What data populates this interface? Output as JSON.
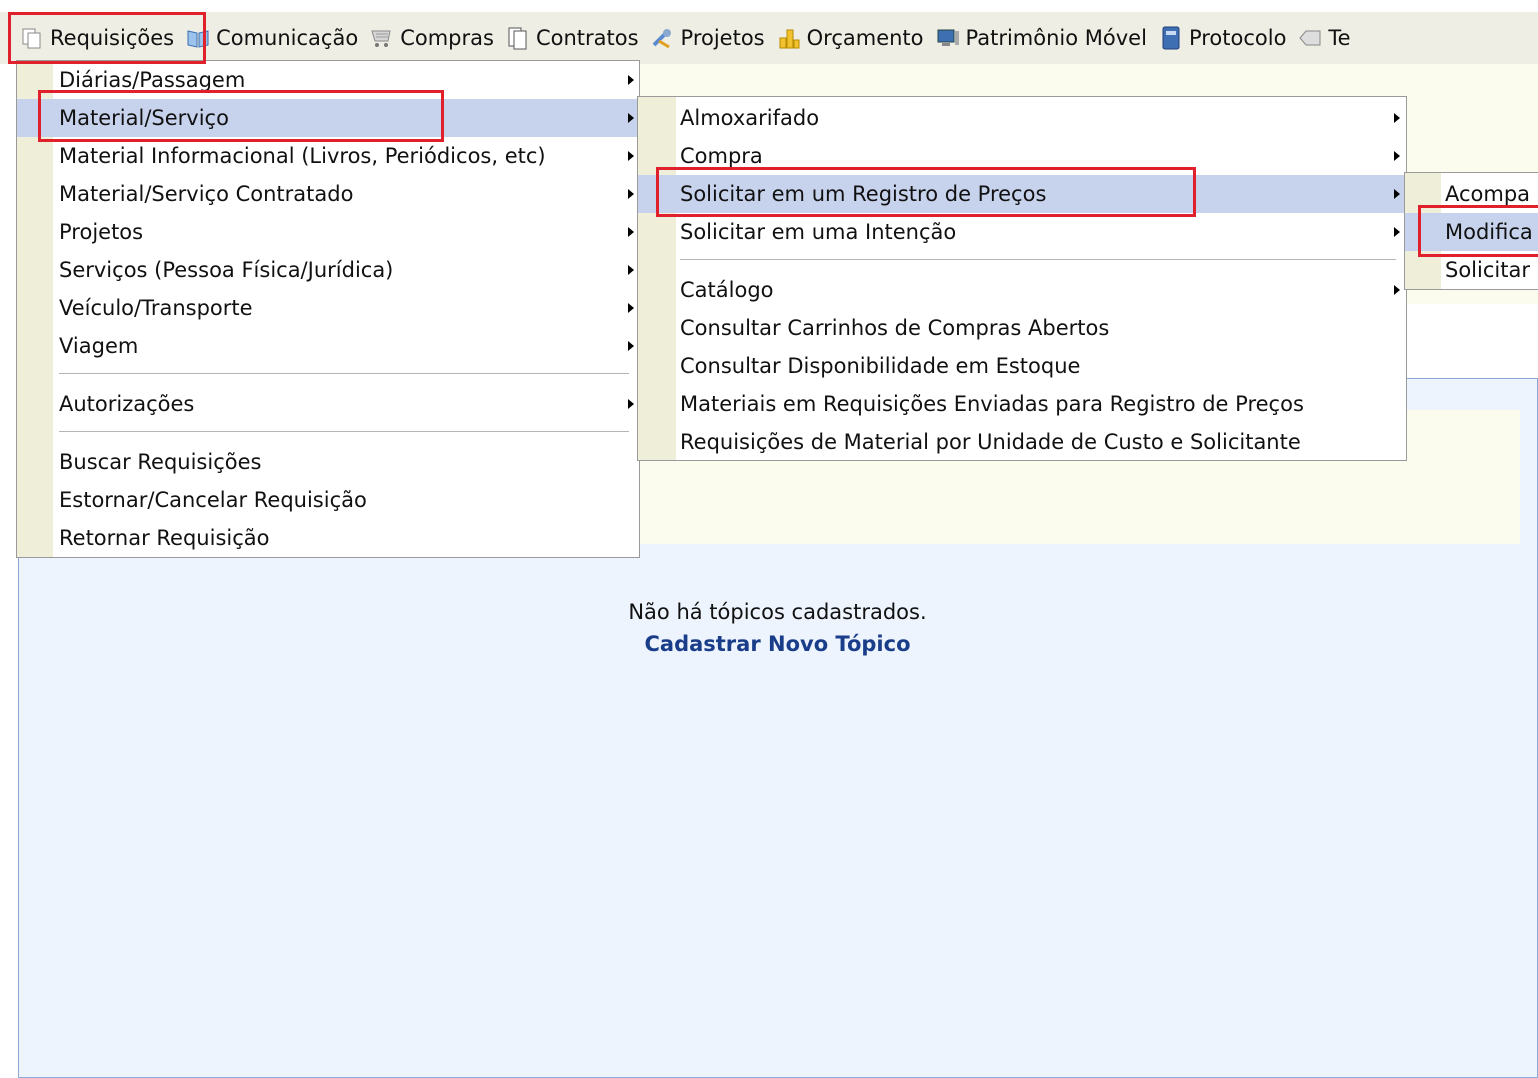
{
  "menubar": {
    "items": [
      {
        "label": "Requisições",
        "icon": "pages-icon"
      },
      {
        "label": "Comunicação",
        "icon": "book-icon"
      },
      {
        "label": "Compras",
        "icon": "cart-icon"
      },
      {
        "label": "Contratos",
        "icon": "document-icon"
      },
      {
        "label": "Projetos",
        "icon": "tools-icon"
      },
      {
        "label": "Orçamento",
        "icon": "coins-icon"
      },
      {
        "label": "Patrimônio Móvel",
        "icon": "computer-icon"
      },
      {
        "label": "Protocolo",
        "icon": "binder-icon"
      },
      {
        "label": "Te",
        "icon": "tag-icon"
      }
    ]
  },
  "menu_requisicoes": {
    "items": [
      {
        "label": "Diárias/Passagem"
      },
      {
        "label": "Material/Serviço"
      },
      {
        "label": "Material Informacional (Livros, Periódicos, etc)"
      },
      {
        "label": "Material/Serviço Contratado"
      },
      {
        "label": "Projetos"
      },
      {
        "label": "Serviços (Pessoa Física/Jurídica)"
      },
      {
        "label": "Veículo/Transporte"
      },
      {
        "label": "Viagem"
      },
      {
        "label": "Autorizações"
      },
      {
        "label": "Buscar Requisições"
      },
      {
        "label": "Estornar/Cancelar Requisição"
      },
      {
        "label": "Retornar Requisição"
      }
    ]
  },
  "menu_material": {
    "items": [
      {
        "label": "Almoxarifado"
      },
      {
        "label": "Compra"
      },
      {
        "label": "Solicitar em um Registro de Preços"
      },
      {
        "label": "Solicitar em uma Intenção"
      },
      {
        "label": "Catálogo"
      },
      {
        "label": "Consultar Carrinhos de Compras Abertos"
      },
      {
        "label": "Consultar Disponibilidade em Estoque"
      },
      {
        "label": "Materiais em Requisições Enviadas para Registro de Preços"
      },
      {
        "label": "Requisições de Material por Unidade de Custo e Solicitante"
      }
    ]
  },
  "menu_registro": {
    "items": [
      {
        "label": "Acompa"
      },
      {
        "label": "Modifica"
      },
      {
        "label": "Solicitar"
      }
    ]
  },
  "content": {
    "empty_message": "Não há tópicos cadastrados.",
    "new_topic_link": "Cadastrar Novo Tópico"
  },
  "colors": {
    "highlight": "#c7d3ec",
    "annotation_red": "#e0202a",
    "link_blue": "#1a3d8a"
  }
}
